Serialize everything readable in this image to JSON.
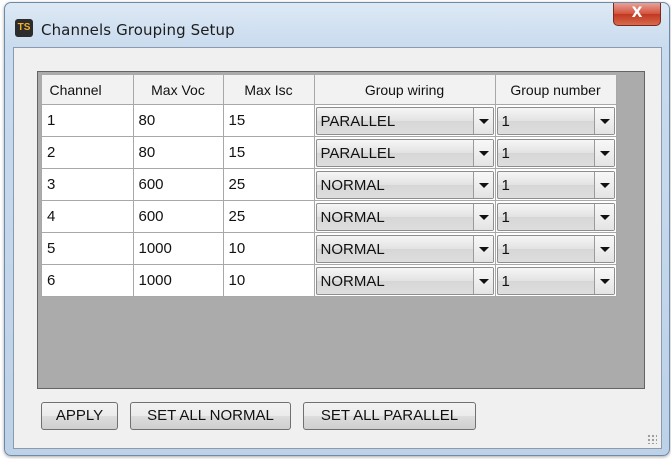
{
  "window": {
    "title": "Channels Grouping Setup",
    "icon": "app-logo-icon",
    "close_label": "X"
  },
  "grid": {
    "headers": [
      "Channel",
      "Max Voc",
      "Max Isc",
      "Group wiring",
      "Group number"
    ],
    "rows": [
      {
        "channel": "1",
        "max_voc": "80",
        "max_isc": "15",
        "wiring": "PARALLEL",
        "group": "1"
      },
      {
        "channel": "2",
        "max_voc": "80",
        "max_isc": "15",
        "wiring": "PARALLEL",
        "group": "1"
      },
      {
        "channel": "3",
        "max_voc": "600",
        "max_isc": "25",
        "wiring": "NORMAL",
        "group": "1"
      },
      {
        "channel": "4",
        "max_voc": "600",
        "max_isc": "25",
        "wiring": "NORMAL",
        "group": "1"
      },
      {
        "channel": "5",
        "max_voc": "1000",
        "max_isc": "10",
        "wiring": "NORMAL",
        "group": "1"
      },
      {
        "channel": "6",
        "max_voc": "1000",
        "max_isc": "10",
        "wiring": "NORMAL",
        "group": "1"
      }
    ]
  },
  "buttons": {
    "apply": "APPLY",
    "set_all_normal": "SET ALL NORMAL",
    "set_all_parallel": "SET ALL PARALLEL"
  },
  "colors": {
    "close_button": "#c7432a",
    "window_frame": "#c9dbee",
    "grid_background": "#ababab"
  }
}
